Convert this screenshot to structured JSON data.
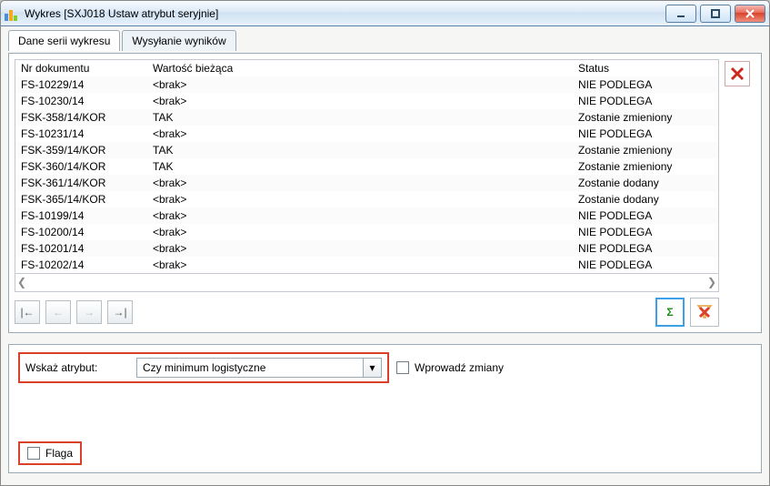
{
  "window": {
    "title": "Wykres [SXJ018 Ustaw atrybut seryjnie]"
  },
  "tabs": {
    "data": "Dane serii wykresu",
    "send": "Wysyłanie wyników"
  },
  "grid": {
    "headers": {
      "doc": "Nr dokumentu",
      "val": "Wartość bieżąca",
      "stat": "Status"
    },
    "rows": [
      {
        "doc": "FS-10229/14",
        "val": "<brak>",
        "stat": "NIE PODLEGA"
      },
      {
        "doc": "FS-10230/14",
        "val": "<brak>",
        "stat": "NIE PODLEGA"
      },
      {
        "doc": "FSK-358/14/KOR",
        "val": "TAK",
        "stat": "Zostanie zmieniony"
      },
      {
        "doc": "FS-10231/14",
        "val": "<brak>",
        "stat": "NIE PODLEGA"
      },
      {
        "doc": "FSK-359/14/KOR",
        "val": "TAK",
        "stat": "Zostanie zmieniony"
      },
      {
        "doc": "FSK-360/14/KOR",
        "val": "TAK",
        "stat": "Zostanie zmieniony"
      },
      {
        "doc": "FSK-361/14/KOR",
        "val": "<brak>",
        "stat": "Zostanie dodany"
      },
      {
        "doc": "FSK-365/14/KOR",
        "val": "<brak>",
        "stat": "Zostanie dodany"
      },
      {
        "doc": "FS-10199/14",
        "val": "<brak>",
        "stat": "NIE PODLEGA"
      },
      {
        "doc": "FS-10200/14",
        "val": "<brak>",
        "stat": "NIE PODLEGA"
      },
      {
        "doc": "FS-10201/14",
        "val": "<brak>",
        "stat": "NIE PODLEGA"
      },
      {
        "doc": "FS-10202/14",
        "val": "<brak>",
        "stat": "NIE PODLEGA"
      }
    ]
  },
  "attr": {
    "label": "Wskaż atrybut:",
    "selected": "Czy minimum logistyczne",
    "apply_label": "Wprowadź zmiany"
  },
  "flag": {
    "label": "Flaga"
  }
}
